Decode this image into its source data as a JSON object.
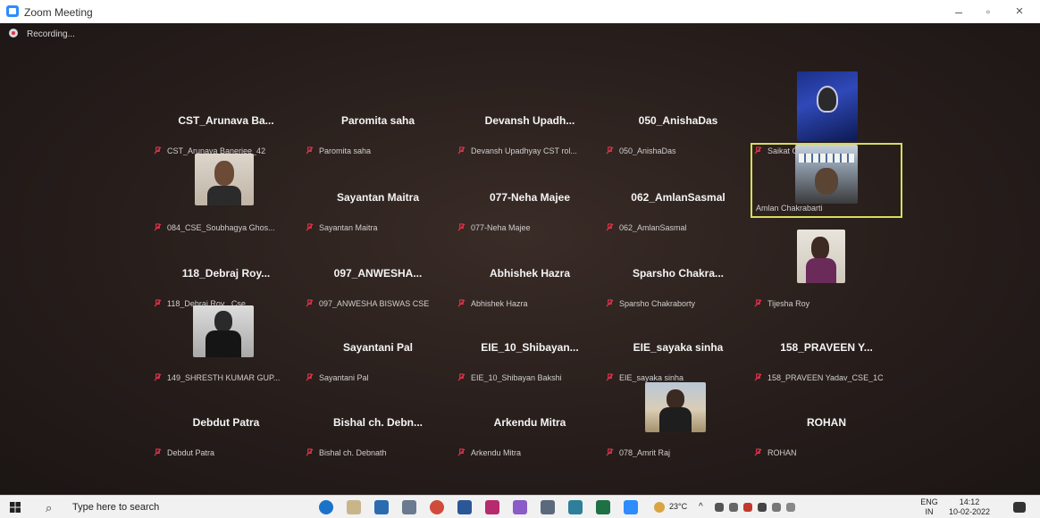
{
  "window": {
    "title": "Zoom Meeting",
    "minimize": "–",
    "maximize": "▫",
    "close": "×"
  },
  "status": {
    "recording": "Recording..."
  },
  "tiles": [
    {
      "name": "CST_Arunava  Ba...",
      "footer": "CST_Arunava Banerjee_42"
    },
    {
      "name": "Paromita saha",
      "footer": "Paromita saha"
    },
    {
      "name": "Devansh  Upadh...",
      "footer": "Devansh Upadhyay CST rol..."
    },
    {
      "name": "050_AnishaDas",
      "footer": "050_AnishaDas"
    },
    {
      "name": "Saikat Chowdhury",
      "footer": "Saikat Chowdhury"
    },
    {
      "name": "",
      "footer": "084_CSE_Soubhagya Ghos..."
    },
    {
      "name": "Sayantan Maitra",
      "footer": "Sayantan Maitra"
    },
    {
      "name": "077-Neha Majee",
      "footer": "077-Neha Majee"
    },
    {
      "name": "062_AmlanSasmal",
      "footer": "062_AmlanSasmal"
    },
    {
      "name": "",
      "footer": "Amlan Chakrabarti"
    },
    {
      "name": "118_Debraj  Roy...",
      "footer": "118_Debraj Roy _Cse"
    },
    {
      "name": "097_ANWESHA...",
      "footer": "097_ANWESHA BISWAS CSE"
    },
    {
      "name": "Abhishek Hazra",
      "footer": "Abhishek Hazra"
    },
    {
      "name": "Sparsho  Chakra...",
      "footer": "Sparsho Chakraborty"
    },
    {
      "name": "",
      "footer": "Tijesha Roy"
    },
    {
      "name": "",
      "footer": "149_SHRESTH KUMAR GUP..."
    },
    {
      "name": "Sayantani Pal",
      "footer": "Sayantani Pal"
    },
    {
      "name": "EIE_10_Shibayan...",
      "footer": "EIE_10_Shibayan Bakshi"
    },
    {
      "name": "EIE_sayaka sinha",
      "footer": "EIE_sayaka sinha"
    },
    {
      "name": "158_PRAVEEN  Y...",
      "footer": "158_PRAVEEN Yadav_CSE_1C"
    },
    {
      "name": "Debdut Patra",
      "footer": "Debdut Patra"
    },
    {
      "name": "Bishal ch.  Debn...",
      "footer": "Bishal ch. Debnath"
    },
    {
      "name": "Arkendu Mitra",
      "footer": "Arkendu Mitra"
    },
    {
      "name": "",
      "footer": "078_Amrit Raj"
    },
    {
      "name": "ROHAN",
      "footer": "ROHAN"
    }
  ],
  "taskbar": {
    "search_placeholder": "Type here to search",
    "weather": "23°C",
    "lang_top": "ENG",
    "lang_bottom": "IN",
    "time": "14:12",
    "date": "10-02-2022"
  },
  "colors": {
    "mic_muted": "#e0324a",
    "active_speaker_border": "#d9dc5a",
    "taskbar_bg": "#f1f1f1"
  }
}
